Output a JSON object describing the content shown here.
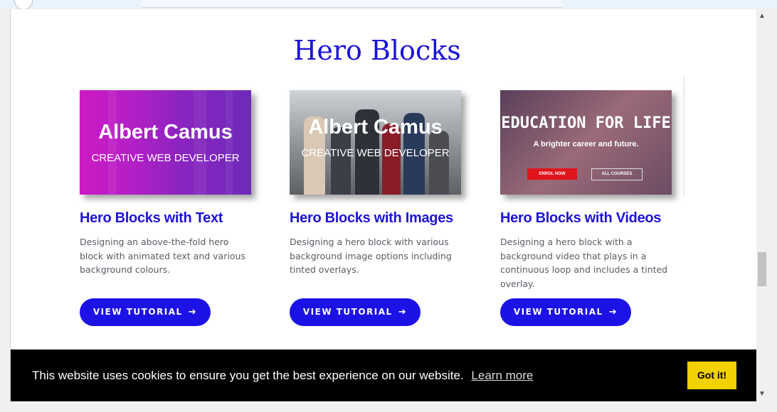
{
  "section": {
    "title": "Hero Blocks"
  },
  "cards": [
    {
      "image": {
        "name": "Albert Camus",
        "subtitle": "CREATIVE WEB DEVELOPER"
      },
      "title": "Hero Blocks with Text",
      "description": "Designing an above-the-fold hero block with animated text and various background colours.",
      "button": "VIEW TUTORIAL"
    },
    {
      "image": {
        "name": "Albert Camus",
        "subtitle": "CREATIVE WEB DEVELOPER"
      },
      "title": "Hero Blocks with Images",
      "description": "Designing a hero block with various background image options including tinted overlays.",
      "button": "VIEW TUTORIAL"
    },
    {
      "image": {
        "title": "EDUCATION FOR LIFE",
        "subtitle": "A brighter career and future.",
        "enrol": "ENROL NOW",
        "courses": "ALL COURSES"
      },
      "title": "Hero Blocks with Videos",
      "description": "Designing a hero block with a background video that plays in a continuous loop and includes a tinted overlay.",
      "button": "VIEW TUTORIAL"
    }
  ],
  "cookie": {
    "message": "This website uses cookies to ensure you get the best experience on our website.",
    "link": "Learn more",
    "button": "Got it!"
  },
  "colors": {
    "accent": "#1c12e6",
    "title": "#1c12d9",
    "cookie_button": "#f2d100"
  },
  "icons": {
    "button_arrow": "arrow-right-icon"
  }
}
